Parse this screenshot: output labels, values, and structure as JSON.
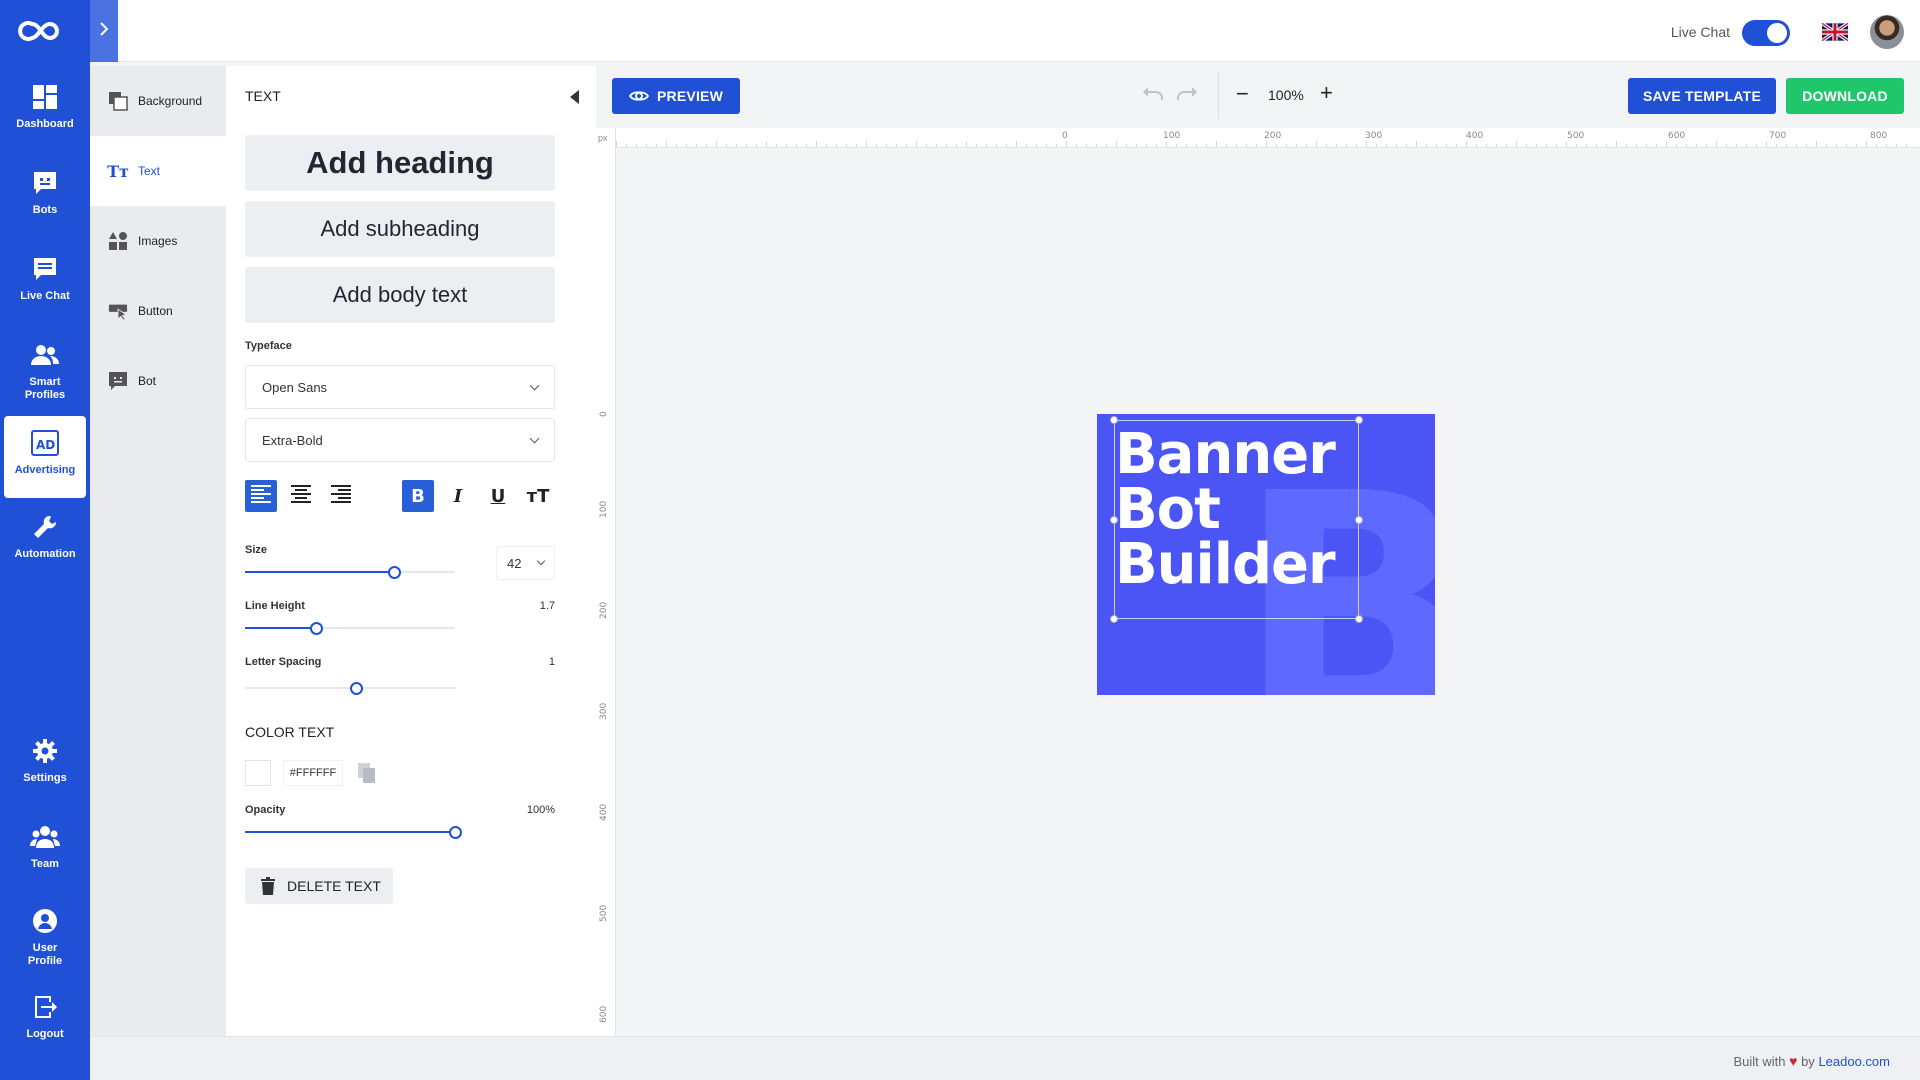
{
  "nav": {
    "items": [
      {
        "label": "Dashboard",
        "icon": "dashboard-icon"
      },
      {
        "label": "Bots",
        "icon": "bot-icon"
      },
      {
        "label": "Live Chat",
        "icon": "chat-icon"
      },
      {
        "label": "Smart Profiles",
        "icon": "users-icon"
      },
      {
        "label": "Advertising",
        "icon": "ad-icon",
        "active": true
      },
      {
        "label": "Automation",
        "icon": "wrench-icon"
      },
      {
        "label": "Settings",
        "icon": "gear-icon"
      },
      {
        "label": "Team",
        "icon": "team-icon"
      },
      {
        "label": "User Profile",
        "icon": "user-circle-icon"
      },
      {
        "label": "Logout",
        "icon": "logout-icon"
      }
    ]
  },
  "topbar": {
    "live_chat_label": "Live Chat",
    "live_chat_enabled": true,
    "language_flag": "uk-flag-icon"
  },
  "categories": [
    {
      "label": "Background",
      "icon": "background-icon"
    },
    {
      "label": "Text",
      "icon": "text-icon",
      "active": true
    },
    {
      "label": "Images",
      "icon": "images-icon"
    },
    {
      "label": "Button",
      "icon": "button-cursor-icon"
    },
    {
      "label": "Bot",
      "icon": "bot-icon"
    }
  ],
  "panel": {
    "title": "TEXT",
    "add_heading": "Add heading",
    "add_subheading": "Add subheading",
    "add_body": "Add body text",
    "typeface_label": "Typeface",
    "font_family": "Open Sans",
    "font_weight": "Extra-Bold",
    "format": {
      "align": "left",
      "bold": true,
      "italic": false,
      "underline": false
    },
    "size_label": "Size",
    "size_value": "42",
    "size_fraction": 0.71,
    "line_height_label": "Line Height",
    "line_height_value": "1.7",
    "line_height_fraction": 0.34,
    "letter_spacing_label": "Letter Spacing",
    "letter_spacing_value": "1",
    "letter_spacing_fraction": 0.53,
    "color_label": "COLOR TEXT",
    "color_hex": "#FFFFFF",
    "opacity_label": "Opacity",
    "opacity_value": "100%",
    "opacity_fraction": 1.0,
    "delete_label": "DELETE TEXT"
  },
  "toolbar": {
    "preview_label": "PREVIEW",
    "zoom_value": "100%",
    "save_label": "SAVE  TEMPLATE",
    "download_label": "DOWNLOAD"
  },
  "rulers": {
    "unit": "px",
    "top_ticks": [
      "0",
      "100",
      "200",
      "300",
      "400",
      "500",
      "600",
      "700",
      "800"
    ],
    "left_ticks": [
      "0",
      "100",
      "200",
      "300",
      "400",
      "500",
      "600"
    ]
  },
  "canvas": {
    "banner_lines": [
      "Banner",
      "Bot",
      "Builder"
    ],
    "banner_bg_letter": "B",
    "banner_color": "#4b55f5"
  },
  "footer": {
    "built_with": "Built with",
    "by": "by",
    "link": "Leadoo.com"
  },
  "colors": {
    "primary": "#1f50d6",
    "save_button": "#1f50d6",
    "download_button": "#20c66a"
  }
}
